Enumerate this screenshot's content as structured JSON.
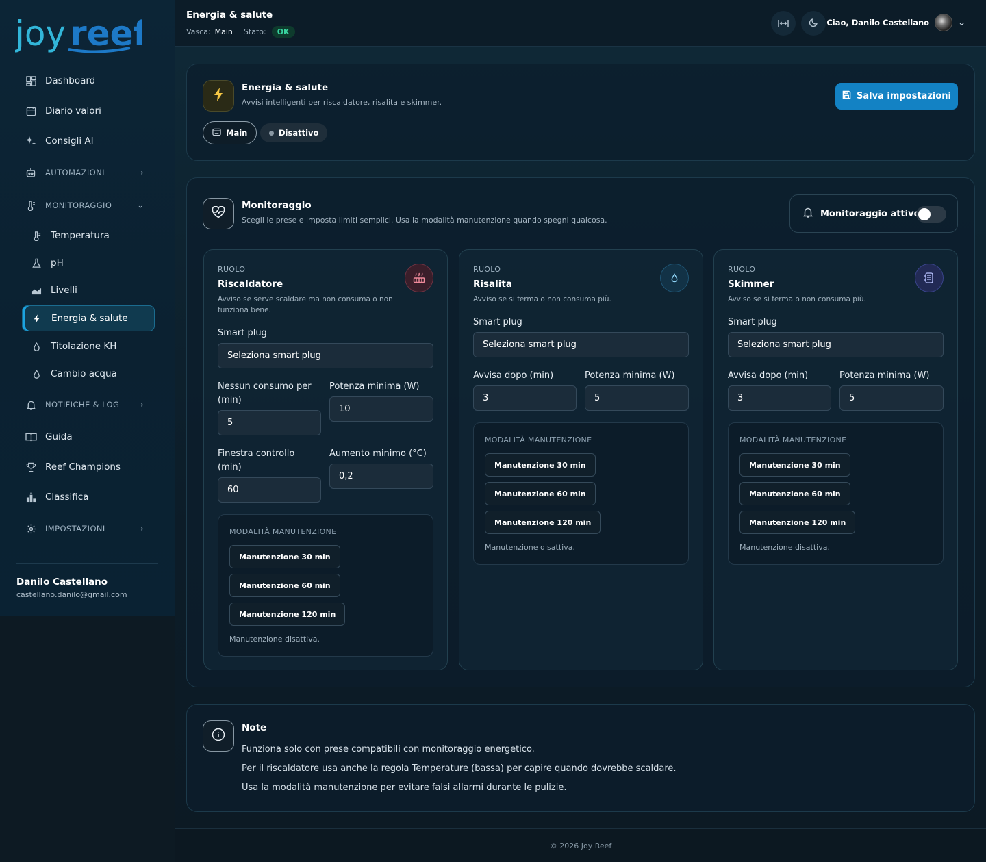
{
  "brand": {
    "logo_part1": "joy",
    "logo_part2": "reef",
    "accent": "#1ba3e0"
  },
  "sidebar": {
    "items": [
      {
        "label": "Dashboard",
        "icon": "dashboard-icon"
      },
      {
        "label": "Diario valori",
        "icon": "calendar-icon"
      },
      {
        "label": "Consigli AI",
        "icon": "sparkles-icon"
      },
      {
        "label": "AUTOMAZIONI",
        "icon": "robot-icon"
      },
      {
        "label": "MONITORAGGIO",
        "icon": "thermometer-icon"
      },
      {
        "label": "Temperatura",
        "icon": "thermometer-icon"
      },
      {
        "label": "pH",
        "icon": "flask-icon"
      },
      {
        "label": "Livelli",
        "icon": "chart-area-icon"
      },
      {
        "label": "Energia & salute",
        "icon": "bolt-icon"
      },
      {
        "label": "Titolazione KH",
        "icon": "drop-icon"
      },
      {
        "label": "Cambio acqua",
        "icon": "drop-icon"
      },
      {
        "label": "NOTIFICHE & LOG",
        "icon": "bell-icon"
      },
      {
        "label": "Guida",
        "icon": "book-icon"
      },
      {
        "label": "Reef Champions",
        "icon": "trophy-icon"
      },
      {
        "label": "Classifica",
        "icon": "ranking-icon"
      },
      {
        "label": "IMPOSTAZIONI",
        "icon": "gear-icon"
      }
    ],
    "user": {
      "name": "Danilo Castellano",
      "email": "castellano.danilo@gmail.com"
    }
  },
  "topbar": {
    "title": "Energia & salute",
    "tank_label": "Vasca:",
    "tank_value": "Main",
    "status_label": "Stato:",
    "status_value": "OK",
    "greeting": "Ciao, Danilo Castellano"
  },
  "header_card": {
    "title": "Energia & salute",
    "subtitle": "Avvisi intelligenti per riscaldatore, risalita e skimmer.",
    "tank_pill": "Main",
    "state_pill": "Disattivo",
    "save_label": "Salva impostazioni"
  },
  "monitor_card": {
    "title": "Monitoraggio",
    "subtitle": "Scegli le prese e imposta limiti semplici. Usa la modalità manutenzione quando spegni qualcosa.",
    "toggle_label": "Monitoraggio attivo",
    "toggle_on": false
  },
  "roles": [
    {
      "role_label": "RUOLO",
      "name": "Riscaldatore",
      "desc": "Avviso se serve scaldare ma non consuma o non funziona bene.",
      "icon": "heater-icon",
      "smart_plug_label": "Smart plug",
      "smart_plug_value": "Seleziona smart plug",
      "field1_label": "Nessun consumo per (min)",
      "field1_value": "5",
      "field2_label": "Potenza minima (W)",
      "field2_value": "10",
      "field3_label": "Finestra controllo (min)",
      "field3_value": "60",
      "field4_label": "Aumento minimo (°C)",
      "field4_value": "0,2",
      "maint_title": "MODALITÀ MANUTENZIONE",
      "maint_buttons": [
        "Manutenzione 30 min",
        "Manutenzione 60 min",
        "Manutenzione 120 min"
      ],
      "maint_status": "Manutenzione disattiva."
    },
    {
      "role_label": "RUOLO",
      "name": "Risalita",
      "desc": "Avviso se si ferma o non consuma più.",
      "icon": "drop-icon",
      "smart_plug_label": "Smart plug",
      "smart_plug_value": "Seleziona smart plug",
      "field1_label": "Avvisa dopo (min)",
      "field1_value": "3",
      "field2_label": "Potenza minima (W)",
      "field2_value": "5",
      "maint_title": "MODALITÀ MANUTENZIONE",
      "maint_buttons": [
        "Manutenzione 30 min",
        "Manutenzione 60 min",
        "Manutenzione 120 min"
      ],
      "maint_status": "Manutenzione disattiva."
    },
    {
      "role_label": "RUOLO",
      "name": "Skimmer",
      "desc": "Avviso se si ferma o non consuma più.",
      "icon": "skimmer-icon",
      "smart_plug_label": "Smart plug",
      "smart_plug_value": "Seleziona smart plug",
      "field1_label": "Avvisa dopo (min)",
      "field1_value": "3",
      "field2_label": "Potenza minima (W)",
      "field2_value": "5",
      "maint_title": "MODALITÀ MANUTENZIONE",
      "maint_buttons": [
        "Manutenzione 30 min",
        "Manutenzione 60 min",
        "Manutenzione 120 min"
      ],
      "maint_status": "Manutenzione disattiva."
    }
  ],
  "notes": {
    "title": "Note",
    "lines": [
      "Funziona solo con prese compatibili con monitoraggio energetico.",
      "Per il riscaldatore usa anche la regola Temperature (bassa) per capire quando dovrebbe scaldare.",
      "Usa la modalità manutenzione per evitare falsi allarmi durante le pulizie."
    ]
  },
  "footer": {
    "text": "© 2026 Joy Reef"
  }
}
